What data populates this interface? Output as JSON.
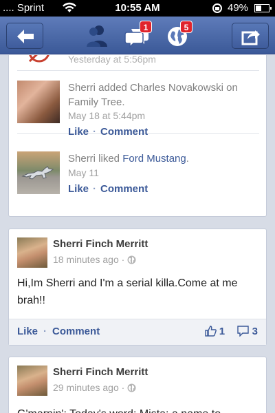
{
  "status_bar": {
    "carrier": ".... Sprint",
    "time": "10:55 AM",
    "battery_pct": "49%",
    "battery_level": 0.49
  },
  "nav": {
    "messages_badge": "1",
    "notifications_badge": "5"
  },
  "activities": [
    {
      "text": "",
      "time": "Yesterday at 5:56pm"
    },
    {
      "text": "Sherri added Charles Novakowski on Family Tree.",
      "time": "May 18 at 5:44pm",
      "like": "Like",
      "comment": "Comment"
    },
    {
      "text_prefix": "Sherri liked ",
      "link": "Ford Mustang",
      "text_suffix": ".",
      "time": "May 11",
      "like": "Like",
      "comment": "Comment"
    }
  ],
  "posts": [
    {
      "author": "Sherri Finch Merritt",
      "time": "18 minutes ago ·",
      "body": "Hi,Im Sherri and I'm a serial killa.Come at me brah!!",
      "like": "Like",
      "comment": "Comment",
      "likes_count": "1",
      "comments_count": "3"
    },
    {
      "author": "Sherri Finch Merritt",
      "time": "29 minutes ago ·",
      "body": "G'marnin': Today's word: Mista: a name to"
    }
  ],
  "colors": {
    "fb_blue": "#3b5998",
    "badge_red": "#e0242b"
  }
}
